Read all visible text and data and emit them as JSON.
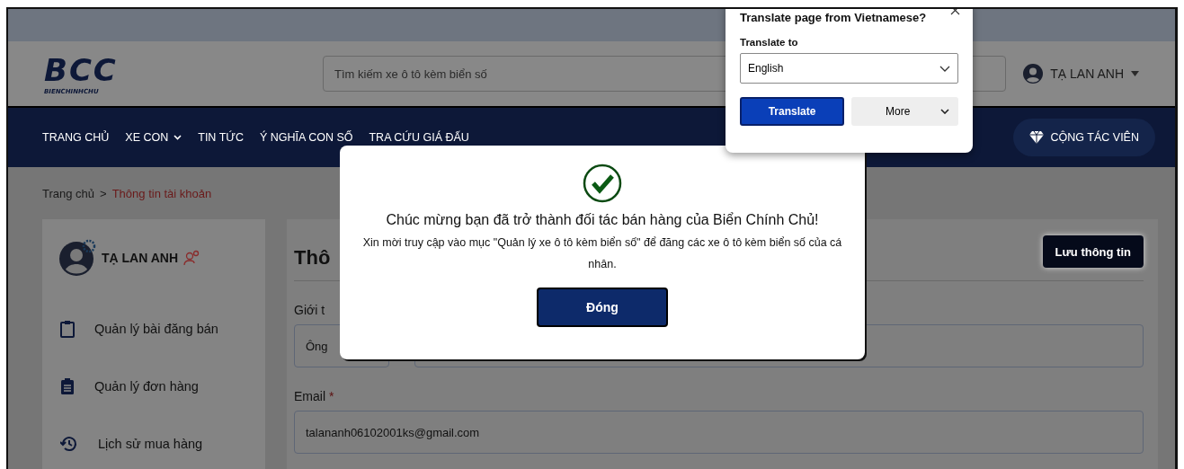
{
  "header": {
    "logo": {
      "mark": "BCC",
      "wordmark": "BIENCHINHCHU"
    },
    "search": {
      "placeholder": "Tìm kiếm xe ô tô kèm biển số"
    },
    "user_name": "TẠ LAN ANH"
  },
  "nav": {
    "items": [
      {
        "label": "TRANG CHỦ",
        "dropdown": false
      },
      {
        "label": "XE CON",
        "dropdown": true
      },
      {
        "label": "TIN TỨC",
        "dropdown": false
      },
      {
        "label": "Ý NGHĨA CON SỐ",
        "dropdown": false
      },
      {
        "label": "TRA CỨU GIÁ ĐẤU",
        "dropdown": false
      }
    ],
    "cta": "CỘNG TÁC VIÊN"
  },
  "breadcrumb": {
    "separator": ">",
    "items": [
      {
        "label": "Trang chủ",
        "current": false
      },
      {
        "label": "Thông tin tài khoản",
        "current": true
      }
    ]
  },
  "sidebar": {
    "user_name": "TẠ LAN ANH",
    "items": [
      {
        "label": "Quản lý bài đăng bán"
      },
      {
        "label": "Quản lý đơn hàng"
      },
      {
        "label": "Lịch sử mua hàng"
      }
    ]
  },
  "main": {
    "title": "Thô",
    "save_button": "Lưu thông tin",
    "gender": {
      "label": "Giới t",
      "value": "Ông"
    },
    "email": {
      "label": "Email",
      "required": true,
      "required_mark": "*",
      "value": "talananh06102001ks@gmail.com"
    }
  },
  "modal": {
    "title": "Chúc mừng bạn đã trở thành đối tác bán hàng của Biển Chính Chủ!",
    "message": "Xin mời truy cập vào mục \"Quản lý xe ô tô kèm biển số\" để đăng các xe ô tô kèm biển số của cá nhân.",
    "button": "Đóng"
  },
  "translate_popup": {
    "title": "Translate page from Vietnamese?",
    "label": "Translate to",
    "language": "English",
    "translate_button": "Translate",
    "more_button": "More"
  }
}
